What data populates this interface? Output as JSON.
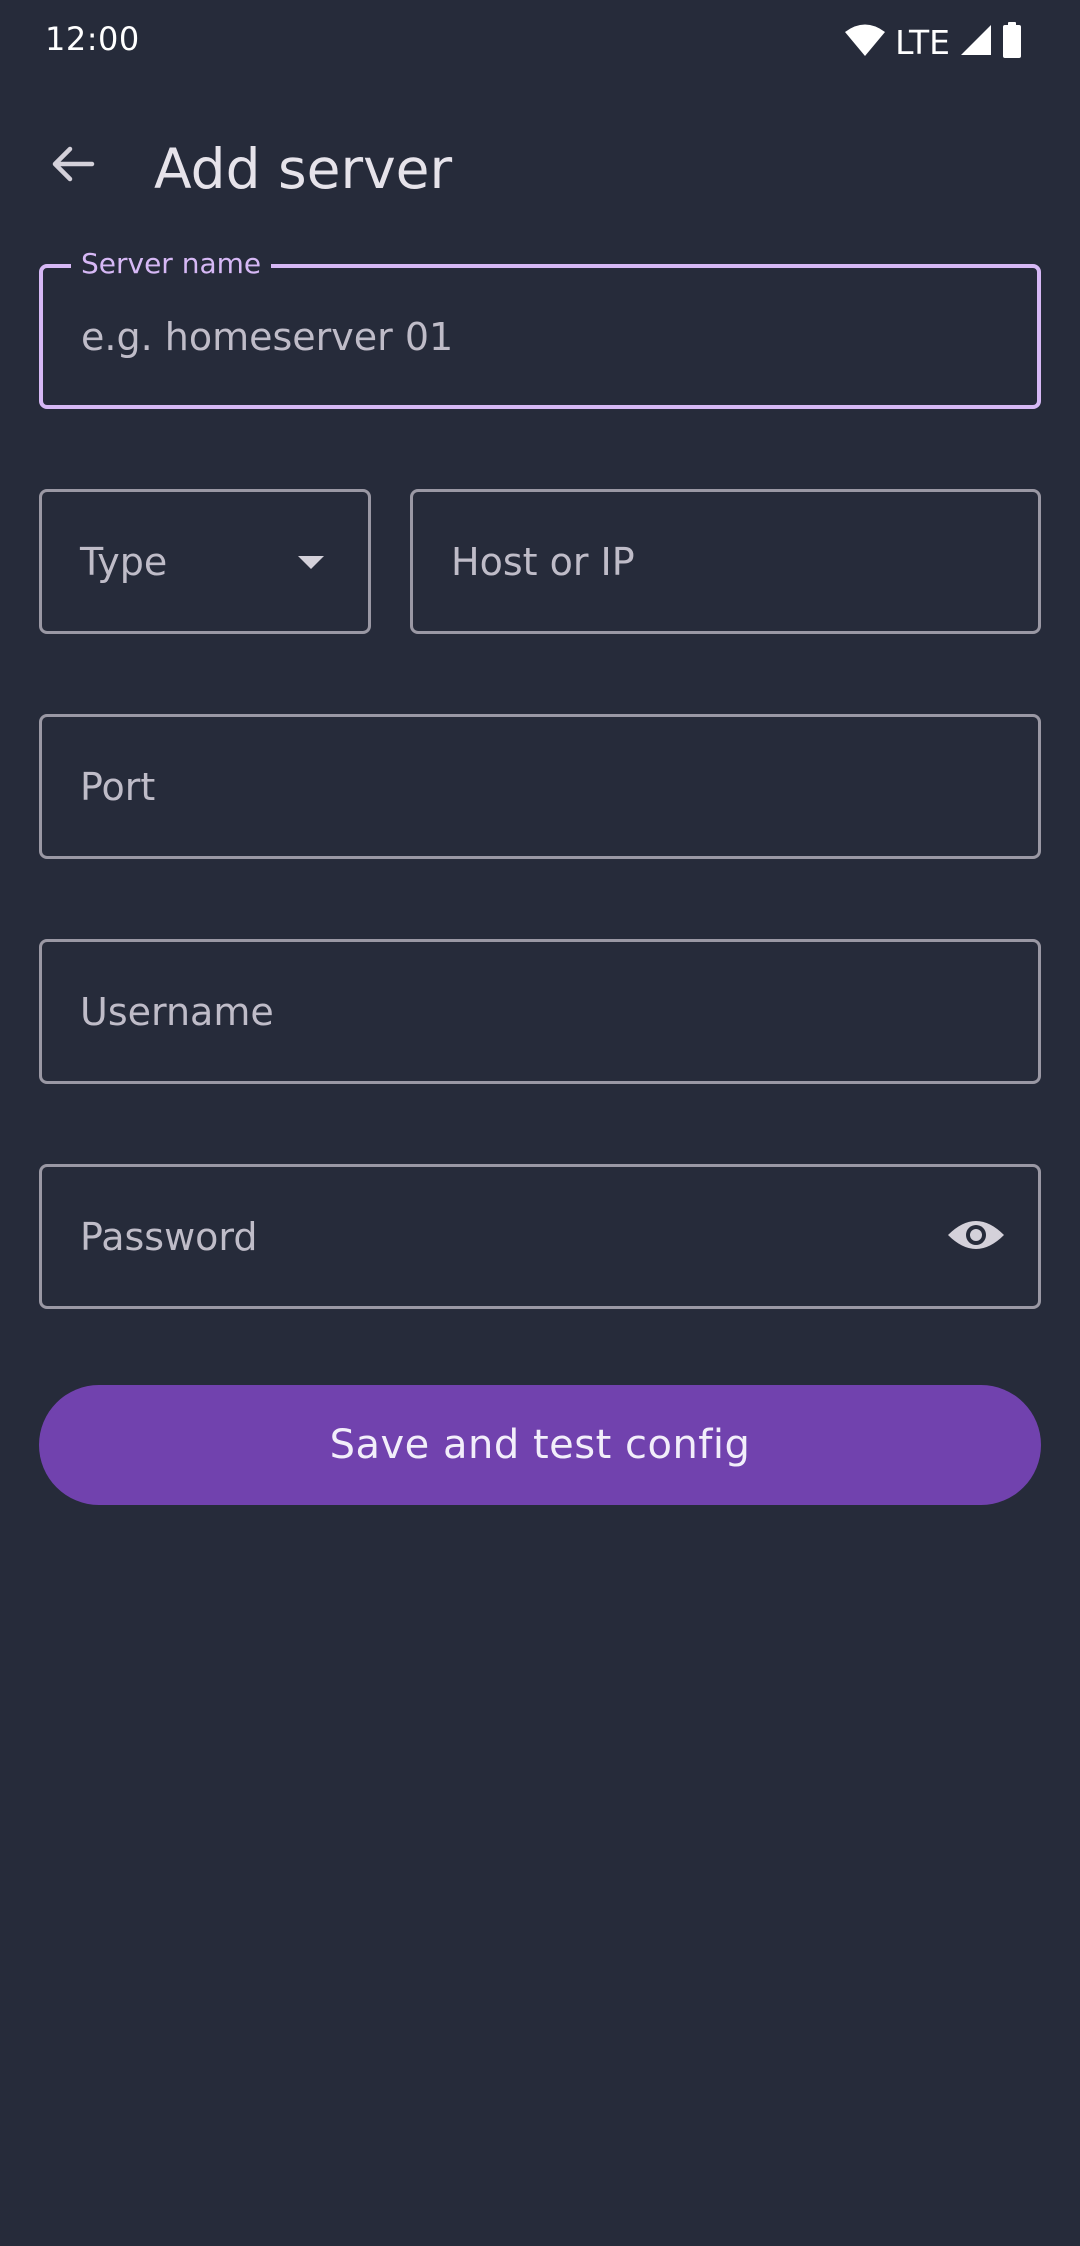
{
  "status_bar": {
    "time": "12:00",
    "network": "LTE",
    "icons": [
      "wifi-icon",
      "signal-icon",
      "battery-icon"
    ]
  },
  "app_bar": {
    "title": "Add server",
    "back_icon": "arrow-back-icon"
  },
  "form": {
    "server_name": {
      "label": "Server name",
      "placeholder": "e.g. homeserver 01",
      "value": ""
    },
    "type": {
      "placeholder": "Type",
      "selected": ""
    },
    "host": {
      "placeholder": "Host or IP",
      "value": ""
    },
    "port": {
      "placeholder": "Port",
      "value": ""
    },
    "username": {
      "placeholder": "Username",
      "value": ""
    },
    "password": {
      "placeholder": "Password",
      "value": "",
      "toggle_icon": "eye-icon"
    }
  },
  "actions": {
    "save_label": "Save and test config"
  },
  "colors": {
    "background": "#262b3a",
    "accent": "#d6b8f5",
    "primary_button": "#7142ae",
    "outline": "#9a98a4"
  }
}
